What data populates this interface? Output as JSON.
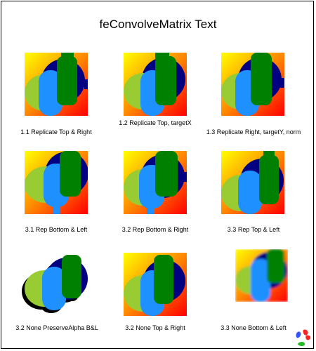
{
  "title": "feConvolveMatrix Text",
  "colors": {
    "grad_yellow": "#ffff00",
    "grad_orange": "#ff8800",
    "grad_red": "#ff0000",
    "shape_navy": "#000080",
    "shape_lime": "#99cc33",
    "shape_blue": "#1e90ff",
    "shape_green": "#008000"
  },
  "tests": [
    {
      "label": "1.1 Replicate Top & Right"
    },
    {
      "label": "1.2 Replicate Top, targetX"
    },
    {
      "label": "1.3 Replicate Right, targetY, norm"
    },
    {
      "label": "3.1 Rep Bottom & Left"
    },
    {
      "label": "3.2 Rep Bottom & Right"
    },
    {
      "label": "3.3 Rep Top & Left"
    },
    {
      "label": "3.2 None PreserveAlpha B&L"
    },
    {
      "label": "3.2 None Top & Right"
    },
    {
      "label": "3.3 None Bottom & Left"
    }
  ],
  "logo": {
    "icon": "svg-logo-icon"
  }
}
